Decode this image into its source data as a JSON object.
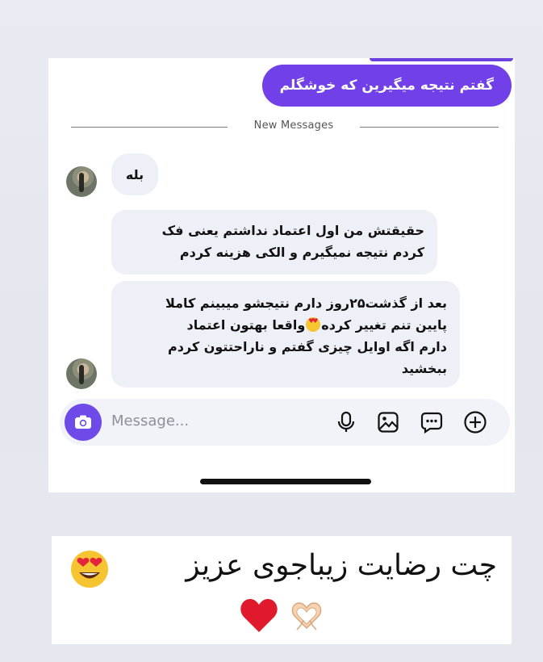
{
  "chat": {
    "sent_message": "گفتم نتیجه میگیرین که خوشگلم",
    "divider_label": "New Messages",
    "received": [
      {
        "line1": "بله"
      },
      {
        "line1": "حقیقتش من اول اعتماد نداشتم یعنی فک",
        "line2": "کردم نتیجه نمیگیرم و الکی هزینه کردم"
      },
      {
        "line1": "بعد از گذشت۲۵روز دارم نتیجشو میبینم کاملا",
        "line2a": "پایین تنم تغییر کرده",
        "line2b": "واقعا بهتون اعتماد",
        "line3": "دارم اگه اوایل چیزی گفتم و ناراحتتون کردم",
        "line4": "ببخشید"
      }
    ]
  },
  "composer": {
    "placeholder": "Message...",
    "icons": [
      "camera-icon",
      "microphone-icon",
      "image-icon",
      "sticker-chat-icon",
      "add-circle-icon"
    ]
  },
  "caption": {
    "title": "چت رضایت زیباجوی عزیز",
    "icons": [
      "heart-eyes-emoji",
      "red-heart-emoji",
      "heart-hands-emoji"
    ]
  },
  "colors": {
    "accent": "#7240e8",
    "received_bubble": "#eef0f7",
    "background": "#e6e8ef"
  }
}
